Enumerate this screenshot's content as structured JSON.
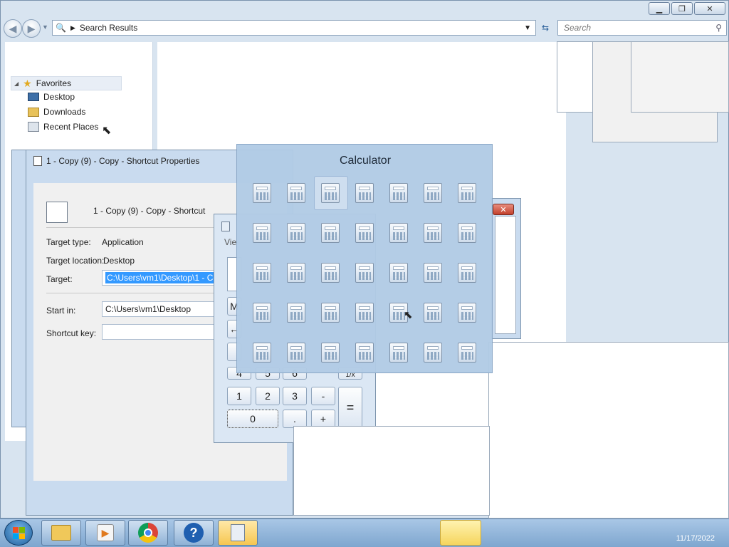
{
  "explorer": {
    "address": "Search Results",
    "search_placeholder": "Search",
    "nav": {
      "favorites": "Favorites",
      "items": [
        {
          "label": "Desktop",
          "icon": "desktop-icon"
        },
        {
          "label": "Downloads",
          "icon": "downloads-folder-icon"
        },
        {
          "label": "Recent Places",
          "icon": "recent-places-icon"
        }
      ]
    }
  },
  "properties": {
    "title": "1 - Copy (9) - Copy - Shortcut Properties",
    "shortcut_name": "1 - Copy (9) - Copy - Shortcut",
    "target_type_label": "Target type:",
    "target_type_value": "Application",
    "target_location_label": "Target location:",
    "target_location_value": "Desktop",
    "target_label": "Target:",
    "target_value": "C:\\Users\\vm1\\Desktop\\1 - Copy",
    "start_in_label": "Start in:",
    "start_in_value": "C:\\Users\\vm1\\Desktop",
    "shortcut_key_label": "Shortcut key:"
  },
  "calculator_window": {
    "menu_view": "Vie",
    "partial_labels": [
      "M",
      "4",
      "5",
      "6",
      "1/x"
    ],
    "buttons": [
      "1",
      "2",
      "3",
      "-",
      "0",
      ".",
      "+",
      "="
    ]
  },
  "flip": {
    "title": "Calculator",
    "rows": 5,
    "cols": 7,
    "selected_index": 2
  },
  "taskbar": {
    "items": [
      "explorer-icon",
      "media-player-icon",
      "chrome-icon",
      "help-icon",
      "calculator-icon"
    ],
    "clock": "11/17/2022"
  }
}
